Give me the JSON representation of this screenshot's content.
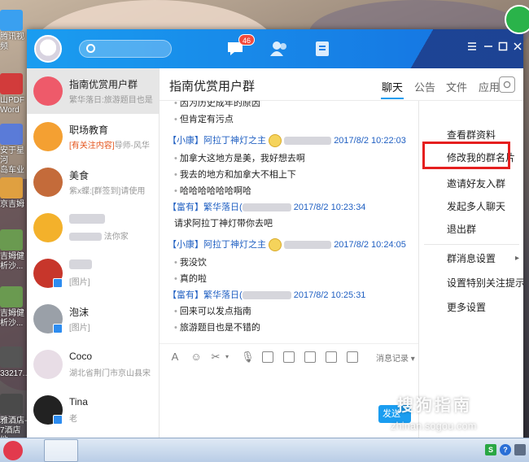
{
  "desktop": {
    "icons": [
      {
        "label": "腾讯视频",
        "color": "#3aa0f0"
      },
      {
        "label": "山PDF\nWord",
        "color": "#d23b3b"
      },
      {
        "label": "安于星河\n岛车业",
        "color": "#5a7bd8"
      },
      {
        "label": "京吉姆",
        "color": "#e0a040"
      },
      {
        "label": "吉姆健\n析沙...",
        "color": "#6a9a50"
      },
      {
        "label": "吉姆健\n析沙...",
        "color": "#6a9a50"
      },
      {
        "label": "33217...",
        "color": "#555"
      },
      {
        "label": "雅酒店-\n7酒店地...",
        "color": "#4a4a4a"
      }
    ]
  },
  "window": {
    "badge_count": "46",
    "accent": "#1a9df0",
    "controls": [
      "≡",
      "—",
      "□",
      "✕"
    ]
  },
  "contacts": [
    {
      "name": "指南优赏用户群",
      "sub_tag": "",
      "sub": "繁华落日:旅游题目也是",
      "color": "#ee5a6a",
      "selected": true
    },
    {
      "name": "职场教育",
      "sub_tag": "[有关注内容]",
      "sub": "导师-风华",
      "color": "#f4a032"
    },
    {
      "name": "美食",
      "sub_tag": "",
      "sub": "紫x蝶:[群签到]请使用",
      "color": "#c46b3a"
    },
    {
      "name": "",
      "sub_tag": "",
      "sub": "法你家",
      "color": "#f3b12b"
    },
    {
      "name": "",
      "sub_tag": "",
      "sub": "[图片]",
      "color": "#c7362b"
    },
    {
      "name": "泡沫",
      "sub_tag": "",
      "sub": "[图片]",
      "color": "#9aa0a8"
    },
    {
      "name": "Coco",
      "sub_tag": "",
      "sub": "湖北省荆门市京山县宋",
      "color": "#e8dde6"
    },
    {
      "name": "Tina",
      "sub_tag": "",
      "sub": "老",
      "color": "#222"
    },
    {
      "name": "",
      "sub_tag": "",
      "sub": "",
      "color": "#ddd"
    }
  ],
  "chat": {
    "title": "指南优赏用户群",
    "tabs": [
      "聊天",
      "公告",
      "文件",
      "应用"
    ],
    "messages": [
      {
        "type": "text",
        "text": "因为历史成年的原因"
      },
      {
        "type": "text",
        "text": "但肯定有污点"
      },
      {
        "type": "head",
        "tag": "【小康】",
        "sender": "阿拉丁神灯之主",
        "time": "2017/8/2 10:22:03"
      },
      {
        "type": "text",
        "text": "加拿大这地方是美，我好想去啊"
      },
      {
        "type": "text",
        "text": "我去的地方和加拿大不相上下"
      },
      {
        "type": "text",
        "text": "哈哈哈哈哈哈啊哈"
      },
      {
        "type": "head",
        "tag": "【富有】",
        "sender": "繁华落日(",
        "time": "2017/8/2 10:23:34"
      },
      {
        "type": "plain",
        "text": "请求阿拉丁神灯带你去吧"
      },
      {
        "type": "head",
        "tag": "【小康】",
        "sender": "阿拉丁神灯之主",
        "time": "2017/8/2 10:24:05"
      },
      {
        "type": "text",
        "text": "我没饮"
      },
      {
        "type": "text",
        "text": "真的啦"
      },
      {
        "type": "head",
        "tag": "【富有】",
        "sender": "繁华落日(",
        "time": "2017/8/2 10:25:31"
      },
      {
        "type": "text",
        "text": "回来可以发点指南"
      },
      {
        "type": "text",
        "text": "旅游题目也是不错的"
      }
    ],
    "history_label": "消息记录",
    "send_label": "发送"
  },
  "menu": {
    "items": [
      {
        "label": "查看群资料"
      },
      {
        "label": "修改我的群名片"
      },
      {
        "label": "邀请好友入群",
        "highlight": true
      },
      {
        "label": "发起多人聊天"
      },
      {
        "label": "退出群"
      },
      {
        "label": "群消息设置",
        "arrow": "▸"
      },
      {
        "label": "设置特别关注提示"
      },
      {
        "label": "更多设置"
      }
    ],
    "highlight_color": "#e51f1f"
  },
  "watermark": {
    "line1": "搜狗指南",
    "line2": "zhinan.sogou.com"
  }
}
